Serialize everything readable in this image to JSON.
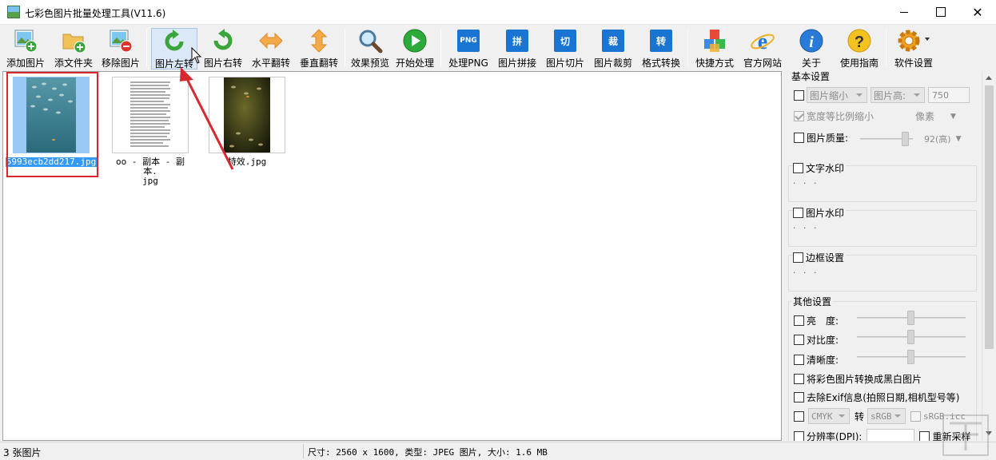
{
  "window": {
    "title": "七彩色图片批量处理工具(V11.6)",
    "close_glyph": "✕"
  },
  "toolbar": [
    {
      "id": "add-images",
      "label": "添加图片",
      "icon": "add-image-icon"
    },
    {
      "id": "add-folder",
      "label": "添文件夹",
      "icon": "add-folder-icon"
    },
    {
      "id": "remove-images",
      "label": "移除图片",
      "icon": "remove-image-icon"
    },
    {
      "id": "rotate-left",
      "label": "图片左转",
      "icon": "rotate-left-icon",
      "active": true
    },
    {
      "id": "rotate-right",
      "label": "图片右转",
      "icon": "rotate-right-icon"
    },
    {
      "id": "flip-horizontal",
      "label": "水平翻转",
      "icon": "flip-horizontal-icon"
    },
    {
      "id": "flip-vertical",
      "label": "垂直翻转",
      "icon": "flip-vertical-icon"
    },
    {
      "id": "preview",
      "label": "效果预览",
      "icon": "magnifier-icon"
    },
    {
      "id": "start",
      "label": "开始处理",
      "icon": "play-icon"
    },
    {
      "id": "process-png",
      "label": "处理PNG",
      "icon": "png-icon",
      "glyph": "PNG"
    },
    {
      "id": "stitch",
      "label": "图片拼接",
      "icon": "stitch-icon",
      "glyph": "拼"
    },
    {
      "id": "slice",
      "label": "图片切片",
      "icon": "slice-icon",
      "glyph": "切"
    },
    {
      "id": "crop",
      "label": "图片裁剪",
      "icon": "crop-icon",
      "glyph": "裁"
    },
    {
      "id": "convert",
      "label": "格式转换",
      "icon": "convert-icon",
      "glyph": "转"
    },
    {
      "id": "shortcut",
      "label": "快捷方式",
      "icon": "cubes-icon"
    },
    {
      "id": "website",
      "label": "官方网站",
      "icon": "ie-browser-icon"
    },
    {
      "id": "about",
      "label": "关于",
      "icon": "info-icon"
    },
    {
      "id": "guide",
      "label": "使用指南",
      "icon": "help-icon"
    },
    {
      "id": "settings",
      "label": "软件设置",
      "icon": "gear-icon"
    }
  ],
  "images": [
    {
      "name": "5993ecb2dd217.jpg",
      "selected": true
    },
    {
      "name_line1": "oo - 副本 - 副本.",
      "name_line2": "jpg"
    },
    {
      "name": "特效.jpg"
    }
  ],
  "panel": {
    "basic": {
      "title": "基本设置",
      "resize_mode": "图片缩小",
      "dimension_mode": "图片高:",
      "dimension_value": "750",
      "keep_ratio_label": "宽度等比例缩小",
      "unit": "像素",
      "quality_label": "图片质量:",
      "quality_value": "92(高)",
      "quality_percent": 92
    },
    "text_watermark": {
      "title": "文字水印",
      "dots": "· · ·"
    },
    "image_watermark": {
      "title": "图片水印",
      "dots": "· · ·"
    },
    "border": {
      "title": "边框设置",
      "dots": "· · ·"
    },
    "other": {
      "title": "其他设置",
      "brightness": "亮　度:",
      "contrast": "对比度:",
      "sharpness": "清晰度:",
      "grayscale": "将彩色图片转换成黑白图片",
      "remove_exif": "去除Exif信息(拍照日期,相机型号等)",
      "color_from": "CMYK",
      "convert_label": "转",
      "color_to": "sRGB",
      "icc_label": "sRGB.icc",
      "dpi_label": "分辨率(DPI):",
      "resample_label": "重新采样"
    }
  },
  "status": {
    "count": "3 张图片",
    "info": "尺寸: 2560 x 1600, 类型: JPEG 图片, 大小: 1.6 MB"
  }
}
